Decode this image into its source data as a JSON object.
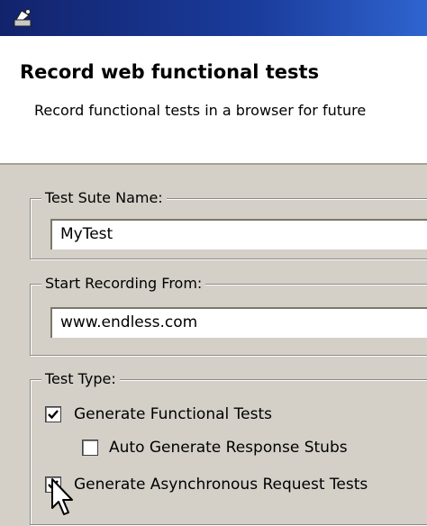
{
  "window": {
    "title": "",
    "icon": "wizard-icon"
  },
  "header": {
    "title": "Record web functional tests",
    "description": "Record functional tests in a browser for future"
  },
  "test_suite": {
    "label": "Test Sute Name:",
    "value": "MyTest"
  },
  "start_recording": {
    "label": "Start Recording From:",
    "value": "www.endless.com"
  },
  "test_type": {
    "label": "Test Type:",
    "options": [
      {
        "label": "Generate Functional Tests",
        "checked": true
      },
      {
        "label": "Auto Generate Response Stubs",
        "checked": false
      },
      {
        "label": "Generate Asynchronous Request Tests",
        "checked": true
      }
    ]
  },
  "cursor": "arrow-cursor-icon",
  "colors": {
    "titlebar": "#1a3c9c",
    "panel": "#d4d0c8"
  }
}
